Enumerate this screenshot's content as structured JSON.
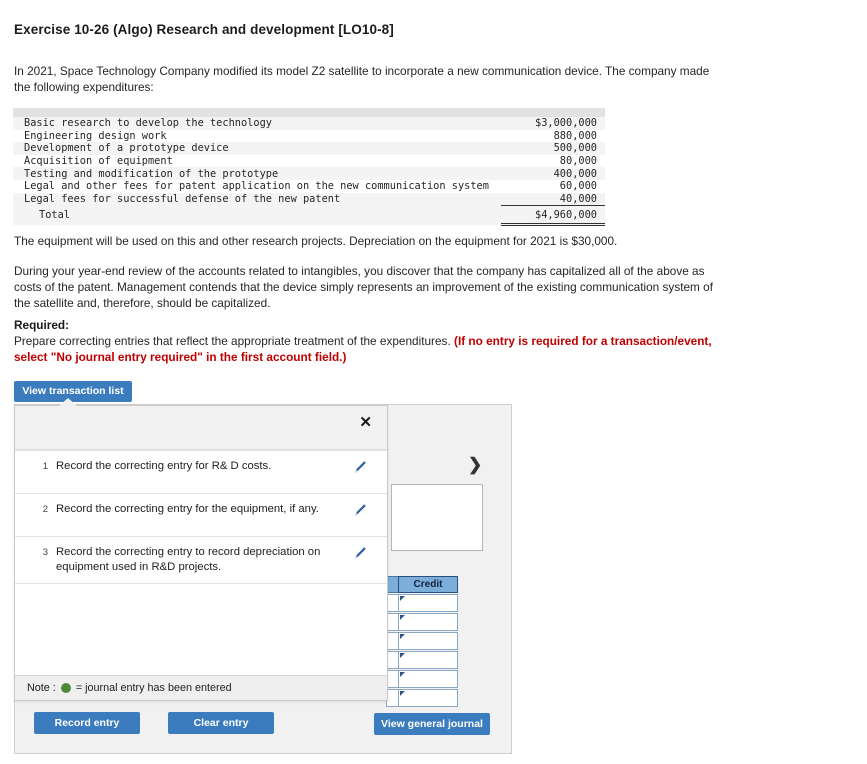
{
  "exercise": {
    "title": "Exercise 10-26 (Algo) Research and development [LO10-8]",
    "intro": "In 2021, Space Technology Company modified its model Z2 satellite to incorporate a new communication device. The company made the following expenditures:",
    "para_equipment": "The equipment will be used on this and other research projects. Depreciation on the equipment for 2021 is $30,000.",
    "para_review": "During your year-end review of the accounts related to intangibles, you discover that the company has capitalized all of the above as costs of the patent. Management contends that the device simply represents an improvement of the existing communication system of the satellite and, therefore, should be capitalized.",
    "required_label": "Required:",
    "required_text": "Prepare correcting entries that reflect the appropriate treatment of the expenditures. ",
    "required_emphasis": "(If no entry is required for a transaction/event, select \"No journal entry required\" in the first account field.)"
  },
  "expenditures": {
    "rows": [
      {
        "label": "Basic research to develop the technology",
        "amount": "$3,000,000"
      },
      {
        "label": "Engineering design work",
        "amount": "880,000"
      },
      {
        "label": "Development of a prototype device",
        "amount": "500,000"
      },
      {
        "label": "Acquisition of equipment",
        "amount": "80,000"
      },
      {
        "label": "Testing and modification of the prototype",
        "amount": "400,000"
      },
      {
        "label": "Legal and other fees for patent application on the new communication system",
        "amount": "60,000"
      },
      {
        "label": "Legal fees for successful defense of the new patent",
        "amount": "40,000"
      }
    ],
    "total_label": "Total",
    "total_amount": "$4,960,000"
  },
  "buttons": {
    "view_transaction_list": "View transaction list",
    "record_entry": "Record entry",
    "clear_entry": "Clear entry",
    "view_general_journal": "View general journal"
  },
  "modal": {
    "close_label": "✕",
    "transactions": [
      {
        "num": "1",
        "desc": "Record the correcting entry for R& D costs."
      },
      {
        "num": "2",
        "desc": "Record the correcting entry for the equipment, if any."
      },
      {
        "num": "3",
        "desc": "Record the correcting entry to record depreciation on equipment used in R&D projects."
      }
    ],
    "note_prefix": "Note :",
    "note_suffix": "= journal entry has been entered"
  },
  "worksheet": {
    "next_chevron": "❯",
    "credit_header": "Credit",
    "grid_rows": 6
  },
  "colors": {
    "accent_blue": "#3a7cbe",
    "header_blue": "#7dadd9",
    "warning_red": "#c00000",
    "entered_green": "#4a8a3a"
  }
}
